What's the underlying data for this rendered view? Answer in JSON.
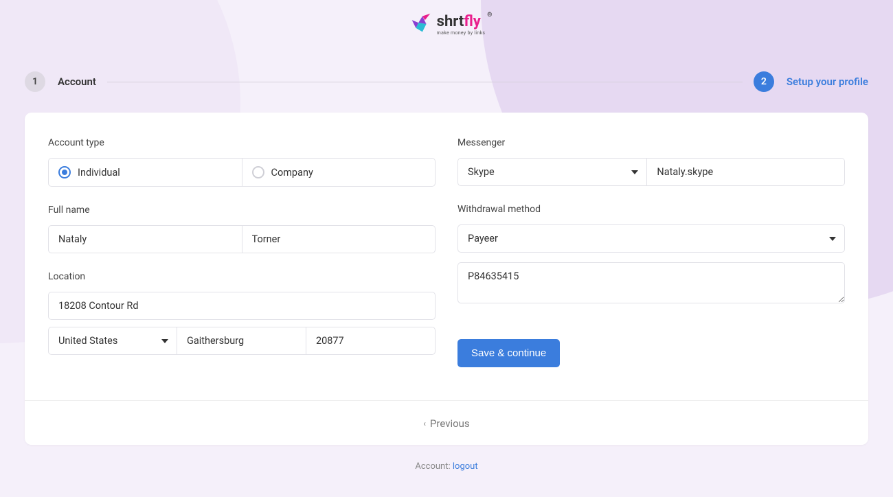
{
  "logo": {
    "brand_main": "shrt",
    "brand_accent": "fly",
    "tagline": "make money by links"
  },
  "wizard": {
    "step1_num": "1",
    "step1_label": "Account",
    "step2_num": "2",
    "step2_label": "Setup your profile"
  },
  "labels": {
    "account_type": "Account type",
    "individual": "Individual",
    "company": "Company",
    "full_name": "Full name",
    "location": "Location",
    "messenger": "Messenger",
    "withdrawal_method": "Withdrawal method"
  },
  "form": {
    "first_name": "Nataly",
    "last_name": "Torner",
    "address": "18208 Contour Rd",
    "country": "United States",
    "city": "Gaithersburg",
    "zip": "20877",
    "messenger_type": "Skype",
    "messenger_value": "Nataly.skype",
    "withdrawal": "Payeer",
    "withdrawal_details": "P84635415"
  },
  "buttons": {
    "save": "Save & continue",
    "previous": "Previous"
  },
  "footer": {
    "prefix": "Account: ",
    "logout": "logout"
  }
}
